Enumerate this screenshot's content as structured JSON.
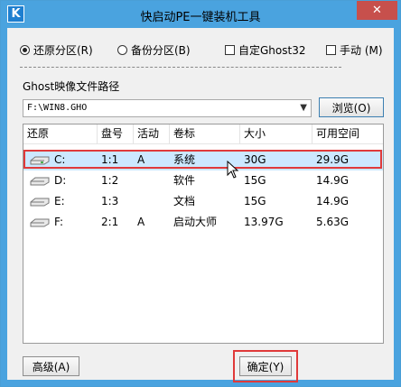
{
  "window": {
    "title": "快启动PE一键装机工具",
    "icon_letter": "K",
    "close_glyph": "✕"
  },
  "options": {
    "restore_label": "还原分区(R)",
    "backup_label": "备份分区(B)",
    "custom_ghost_label": "自定Ghost32",
    "manual_label": "手动 (M)",
    "restore_selected": true
  },
  "ghost_path": {
    "label": "Ghost映像文件路径",
    "value": "F:\\WIN8.GHO",
    "browse_label": "浏览(O)"
  },
  "partitions": {
    "headers": [
      "还原",
      "盘号",
      "活动",
      "卷标",
      "大小",
      "可用空间"
    ],
    "rows": [
      {
        "drive": "C:",
        "disk": "1:1",
        "active": "A",
        "label": "系统",
        "size": "30G",
        "free": "29.9G",
        "selected": true
      },
      {
        "drive": "D:",
        "disk": "1:2",
        "active": "",
        "label": "软件",
        "size": "15G",
        "free": "14.9G",
        "selected": false
      },
      {
        "drive": "E:",
        "disk": "1:3",
        "active": "",
        "label": "文档",
        "size": "15G",
        "free": "14.9G",
        "selected": false
      },
      {
        "drive": "F:",
        "disk": "2:1",
        "active": "A",
        "label": "启动大师",
        "size": "13.97G",
        "free": "5.63G",
        "selected": false
      }
    ]
  },
  "buttons": {
    "advanced_label": "高级(A)",
    "ok_label": "确定(Y)"
  },
  "colors": {
    "titlebar": "#4aa3df",
    "close": "#c7504c",
    "selection": "#cce8ff",
    "annotation": "#e03a3a"
  }
}
